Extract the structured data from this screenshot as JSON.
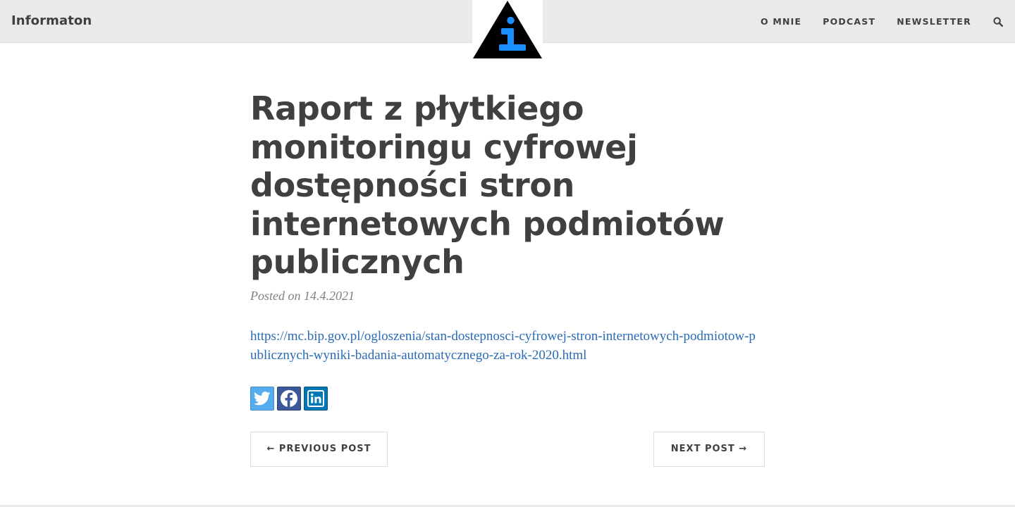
{
  "site": {
    "brand": "Informaton"
  },
  "nav": {
    "items": [
      {
        "label": "O MNIE"
      },
      {
        "label": "PODCAST"
      },
      {
        "label": "NEWSLETTER"
      }
    ],
    "search_icon": "search-icon"
  },
  "logo": {
    "glyph": "i",
    "triangle_color": "#000000",
    "glyph_color": "#1a8fff"
  },
  "post": {
    "title": "Raport z płytkiego monitoringu cyfrowej dostępności stron internetowych podmiotów publicznych",
    "meta": "Posted on 14.4.2021",
    "link": "https://mc.bip.gov.pl/ogloszenia/stan-dostepnosci-cyfrowej-stron-internetowych-podmiotow-publicznych-wyniki-badania-automatycznego-za-rok-2020.html"
  },
  "share": [
    {
      "icon": "twitter-icon",
      "color": "#55acee"
    },
    {
      "icon": "facebook-icon",
      "color": "#3b5998"
    },
    {
      "icon": "linkedin-icon",
      "color": "#0077b5"
    }
  ],
  "pager": {
    "previous": "← PREVIOUS POST",
    "next": "NEXT POST →"
  },
  "colors": {
    "navbar_bg": "#eaeaea",
    "text": "#404040",
    "link": "#2a6bb8",
    "meta": "#808080"
  }
}
